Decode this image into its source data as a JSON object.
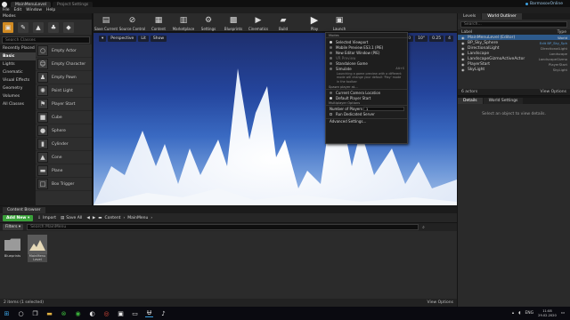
{
  "titlebar": {
    "tabs": [
      {
        "label": "MainMenuLevel"
      },
      {
        "label": "Project Settings"
      }
    ],
    "user": "BarmasovOnline"
  },
  "menubar": {
    "items": [
      "File",
      "Edit",
      "Window",
      "Help"
    ]
  },
  "modes": {
    "title": "Modes",
    "search_placeholder": "Search Classes",
    "categories": [
      "Recently Placed",
      "Basic",
      "Lights",
      "Cinematic",
      "Visual Effects",
      "Geometry",
      "Volumes",
      "All Classes"
    ],
    "selected_category": "Basic",
    "items": [
      "Empty Actor",
      "Empty Character",
      "Empty Pawn",
      "Point Light",
      "Player Start",
      "Cube",
      "Sphere",
      "Cylinder",
      "Cone",
      "Plane",
      "Box Trigger"
    ]
  },
  "toolbar": {
    "buttons": [
      {
        "label": "Save Current",
        "icon": "save-icon"
      },
      {
        "label": "Source Control",
        "icon": "source-control-icon"
      },
      {
        "label": "Content",
        "icon": "content-icon"
      },
      {
        "label": "Marketplace",
        "icon": "marketplace-icon"
      },
      {
        "label": "Settings",
        "icon": "settings-icon"
      },
      {
        "label": "Blueprints",
        "icon": "blueprints-icon"
      },
      {
        "label": "Cinematics",
        "icon": "cinematics-icon"
      },
      {
        "label": "Build",
        "icon": "build-icon"
      },
      {
        "label": "Play",
        "icon": "play-icon"
      },
      {
        "label": "Launch",
        "icon": "launch-icon"
      }
    ]
  },
  "viewport": {
    "chips_left": [
      "Perspective",
      "Lit",
      "Show"
    ],
    "chips_right": [
      "10",
      "10°",
      "0.25",
      "4"
    ]
  },
  "play_menu": {
    "section_modes": "Modes",
    "items": [
      {
        "label": "Selected Viewport",
        "active": true,
        "kb": ""
      },
      {
        "label": "Mobile Preview ES3.1 (PIE)",
        "active": false,
        "kb": ""
      },
      {
        "label": "New Editor Window (PIE)",
        "active": false,
        "kb": ""
      },
      {
        "label": "VR Preview",
        "active": false,
        "kb": "",
        "dim": true
      },
      {
        "label": "Standalone Game",
        "active": false,
        "kb": ""
      },
      {
        "label": "Simulate",
        "active": false,
        "kb": "Alt+S"
      }
    ],
    "description": "Launching a game preview with a different mode will change your default 'Play' mode in the toolbar",
    "section_spawn": "Spawn player at...",
    "spawn_items": [
      {
        "label": "Current Camera Location",
        "active": false
      },
      {
        "label": "Default Player Start",
        "active": true
      }
    ],
    "section_multiplayer": "Multiplayer Options",
    "players_label": "Number of Players",
    "players_value": "1",
    "dedicated_label": "Run Dedicated Server",
    "advanced_label": "Advanced Settings..."
  },
  "right_tabs": [
    "Levels",
    "World Outliner"
  ],
  "outliner": {
    "search_placeholder": "Search...",
    "col_label": "Label",
    "col_type": "Type",
    "rows": [
      {
        "label": "MainMenuLevel (Editor)",
        "type": "World",
        "selected": true
      },
      {
        "label": "BP_Sky_Sphere",
        "type": "Edit BP_Sky_Sph"
      },
      {
        "label": "DirectionalLight",
        "type": "DirectionalLight"
      },
      {
        "label": "Landscape",
        "type": "Landscape"
      },
      {
        "label": "LandscapeGizmoActiveActor",
        "type": "LandscapeGizmo"
      },
      {
        "label": "PlayerStart",
        "type": "PlayerStart"
      },
      {
        "label": "SkyLight",
        "type": "SkyLight"
      }
    ],
    "count": "6 actors",
    "view_options": "View Options"
  },
  "details_tabs": [
    "Details",
    "World Settings"
  ],
  "details_message": "Select an object to view details.",
  "content_browser": {
    "tab": "Content Browser",
    "add_new": "Add New",
    "import": "Import",
    "save_all": "Save All",
    "path": [
      "Content",
      "MainMenu"
    ],
    "filters": "Filters",
    "search_placeholder": "Search MainMenu",
    "assets": [
      {
        "label": "Blueprints",
        "kind": "folder"
      },
      {
        "label": "MainMenu Level",
        "kind": "level"
      }
    ],
    "status": "2 items (1 selected)",
    "view_options": "View Options"
  },
  "taskbar": {
    "icons": [
      "windows-icon",
      "search-icon",
      "task-view-icon",
      "explorer-icon",
      "xbox-icon",
      "spotify-icon",
      "steam-icon",
      "browser-icon",
      "terminal-icon",
      "monitor-icon",
      "unreal-icon",
      "music-icon"
    ],
    "lang": "ENG",
    "time": "11:08",
    "date": "29.02.2020"
  }
}
